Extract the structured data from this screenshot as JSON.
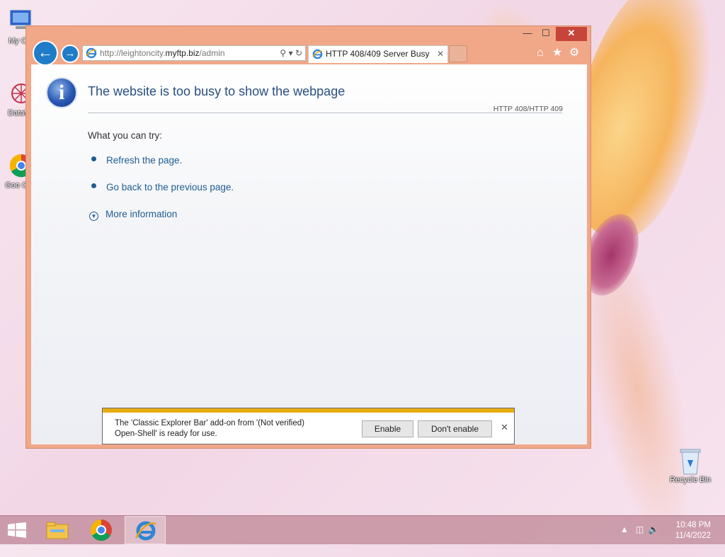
{
  "desktop": {
    "icons": [
      {
        "label": "My Co",
        "icon": "computer-icon"
      },
      {
        "label": "DataW",
        "icon": "datawrapper-icon"
      },
      {
        "label": "Goo Chr",
        "icon": "chrome-icon"
      },
      {
        "label": "Recycle Bin",
        "icon": "recycle-bin-icon"
      }
    ]
  },
  "browser": {
    "address": {
      "prefix": "http://leightoncity.",
      "domain": "myftp.biz",
      "path": "/admin"
    },
    "tab": {
      "title": "HTTP 408/409 Server Busy"
    },
    "window_controls": {
      "minimize": "—",
      "maximize": "☐",
      "close": "✕"
    },
    "toolbar_icons": [
      "home-icon",
      "favorites-icon",
      "settings-icon"
    ]
  },
  "page": {
    "headline": "The website is too busy to show the webpage",
    "http_code": "HTTP 408/HTTP 409",
    "what_you_can_try": "What you can try:",
    "options": [
      "Refresh the page.",
      "Go back to the previous page."
    ],
    "more_info": "More information"
  },
  "notification": {
    "line1": "The 'Classic Explorer Bar' add-on from '(Not verified)",
    "line2": "Open-Shell' is ready for use.",
    "enable": "Enable",
    "dont_enable": "Don't enable"
  },
  "taskbar": {
    "time": "10:48 PM",
    "date": "11/4/2022",
    "apps": [
      "start-icon",
      "file-explorer-icon",
      "chrome-icon",
      "internet-explorer-icon"
    ]
  },
  "colors": {
    "window_frame": "#f0a889",
    "link": "#1f5c93",
    "headline": "#2a4f7f",
    "close_button": "#c7443a",
    "notification_bar": "#e7ac14"
  }
}
